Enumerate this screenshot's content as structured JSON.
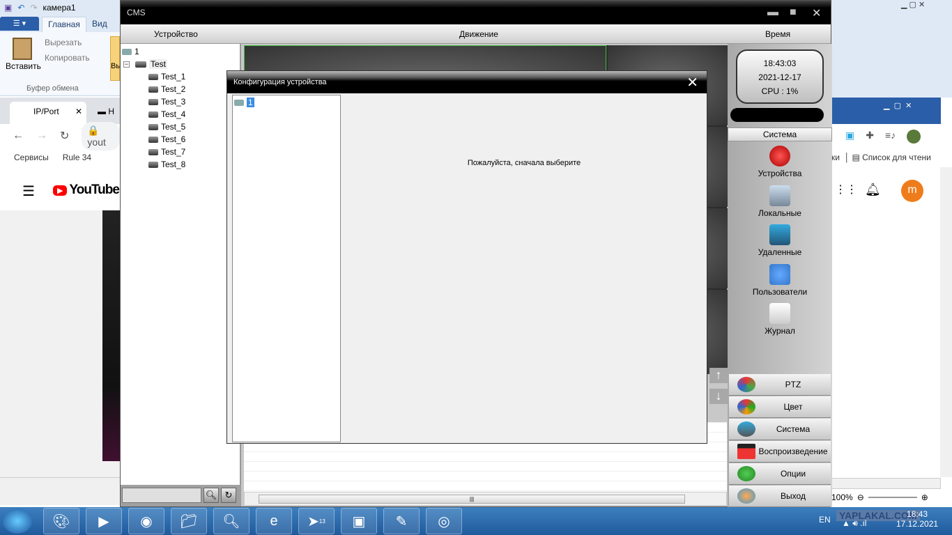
{
  "paint": {
    "title": "камера1",
    "tabs": [
      "Главная",
      "Вид"
    ],
    "paste": "Вставить",
    "cut": "Вырезать",
    "copy": "Копировать",
    "group": "Буфер обмена",
    "partial": "Вы"
  },
  "chrome": {
    "tab1": "IP/Port",
    "tab2": "Н",
    "url": "yout",
    "bookmarks": [
      "Сервисы",
      "Rule 34"
    ],
    "reading_list": "Список для чтени",
    "bm_partial": "ки",
    "youtube": "YouTube",
    "avatar": "m",
    "zoom": "100%"
  },
  "cms": {
    "title": "CMS",
    "header": {
      "device": "Устройство",
      "motion": "Движение",
      "time": "Время"
    },
    "tree": {
      "root": "1",
      "group": "Test",
      "cameras": [
        "Test_1",
        "Test_2",
        "Test_3",
        "Test_4",
        "Test_5",
        "Test_6",
        "Test_7",
        "Test_8"
      ]
    },
    "clock": {
      "time": "18:43:03",
      "date": "2021-12-17",
      "cpu": "CPU : 1%"
    },
    "system_header": "Система",
    "system_items": [
      "Устройства",
      "Локальные",
      "Удаленные",
      "Пользователи",
      "Журнал"
    ],
    "buttons": [
      "PTZ",
      "Цвет",
      "Система",
      "Воспроизведение",
      "Опции",
      "Выход"
    ]
  },
  "dialog": {
    "title": "Конфигурация устройства",
    "tree_root": "1",
    "message": "Пожалуйста, сначала выберите"
  },
  "taskbar": {
    "lang": "EN",
    "time": "18:43",
    "date": "17.12.2021",
    "watermark": "YAPLAKAL.COM",
    "telegram_badge": "13"
  }
}
